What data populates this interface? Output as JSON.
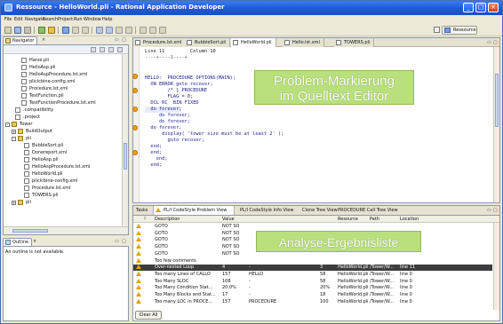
{
  "window": {
    "title": "Ressource - HelloWorld.pli - Rational Application Developer",
    "min": "_",
    "max": "□",
    "close": "×"
  },
  "menu": [
    "File",
    "Edit",
    "Navigate",
    "Search",
    "Project",
    "Run",
    "Window",
    "Help"
  ],
  "toolbar": {
    "resource_label": "Ressource"
  },
  "navigator": {
    "tab_label": "Navigator",
    "items": [
      "Hanoi.pli",
      "HelloAsp.pli",
      "HelloAspProcedure.lst.xml",
      "pliclcbine-config.xml",
      "Procedure.lst.xml",
      "TestFunction.pli",
      "TestFunctionProcedure.lst.xml",
      ".compatibility",
      ".project",
      "Tower",
      "BuildOutput",
      "pli",
      "BubbleSort.pli",
      "Donereport.xml",
      "HelloAsp.pli",
      "HelloAspProcedure.lst.xml",
      "HelloWorld.pli",
      "pliclcbine-config.xml",
      "Procedure.lst.xml",
      "TOWERS.pli",
      "pli"
    ]
  },
  "outline": {
    "tab_label": "Outline",
    "empty_text": "An outline is not available."
  },
  "editor": {
    "tabs": [
      "Procedure.lst.xml",
      "BubbleSort.pli",
      "HelloWorld.pli",
      "Hello.lst.xml",
      "TOWERS.pli"
    ],
    "ruler": "Line 11         Column 10",
    "ruler2": "----+----1----+",
    "code": [
      "HELLO:  PROCEDURE OPTIONS(MAIN);",
      "  ON ERROR goto recover;",
      "        /* } PROCEDURE",
      "        FLAG = 0;",
      "  DCL RC  BIN FIXED",
      "  do forever;",
      "     do forever;",
      "     do forever;",
      "  do forever;",
      "      display( 'tower size must be at least 2' );",
      "        goto recover;",
      "  end;",
      "  end;",
      "    end;",
      "  end;"
    ]
  },
  "callout_top": {
    "line1": "Problem-Markierung",
    "line2": "im Quelltext Editor"
  },
  "callout_bottom": {
    "text": "Analyse-Ergebnisliste"
  },
  "problems": {
    "tabs": [
      "Tasks",
      "PL/I CodeStyle Problem View",
      "PL/I CodeStyle Info View",
      "Clone Tree View",
      "PROCEDURE Call Tree View"
    ],
    "headers": [
      "!",
      "Description",
      "Value",
      "",
      "",
      "Resource",
      "Path",
      "Location"
    ],
    "rows": [
      [
        "GOTO",
        "NOT SO",
        "",
        "",
        "",
        "",
        ""
      ],
      [
        "GOTO",
        "NOT SO",
        "",
        "",
        "",
        "",
        ""
      ],
      [
        "GOTO",
        "NOT SO",
        "",
        "",
        "",
        "",
        ""
      ],
      [
        "GOTO",
        "NOT SO",
        "",
        "",
        "",
        "",
        ""
      ],
      [
        "GOTO",
        "NOT SO",
        "",
        "",
        "",
        "",
        ""
      ],
      [
        "Too few comments",
        "",
        "",
        "",
        "",
        "",
        ""
      ],
      [
        "Over-nested Loop",
        "4",
        "-",
        "3",
        "HelloWorld.pli",
        "/Tower/W...",
        "line 11"
      ],
      [
        "Too many Lines of CALLO",
        "157",
        "HELLO",
        "58",
        "HelloWorld.pli",
        "/Tower/W...",
        "line 0"
      ],
      [
        "Too Many SLOC",
        "108",
        "-",
        "58",
        "HelloWorld.pli",
        "/Tower/W...",
        "line 0"
      ],
      [
        "Too Many Condition Stat...",
        "20.0%",
        "-",
        "20%",
        "HelloWorld.pli",
        "/Tower/W...",
        "line 0"
      ],
      [
        "Too Many Blocks and Stat...",
        "17",
        "-",
        "18",
        "HelloWorld.pli",
        "/Tower/W...",
        "line 0"
      ],
      [
        "Too many LOC in PROCE...",
        "157",
        "PROCEDURE",
        "100",
        "HelloWorld.pli",
        "/Tower/W...",
        "line 0"
      ]
    ],
    "clear_label": "Clear All"
  },
  "colors": {
    "titlebar": "#1f5fd8",
    "callout": "#b9e07d",
    "warning": "#e0a000",
    "selected_row": "#3d3d3d"
  }
}
